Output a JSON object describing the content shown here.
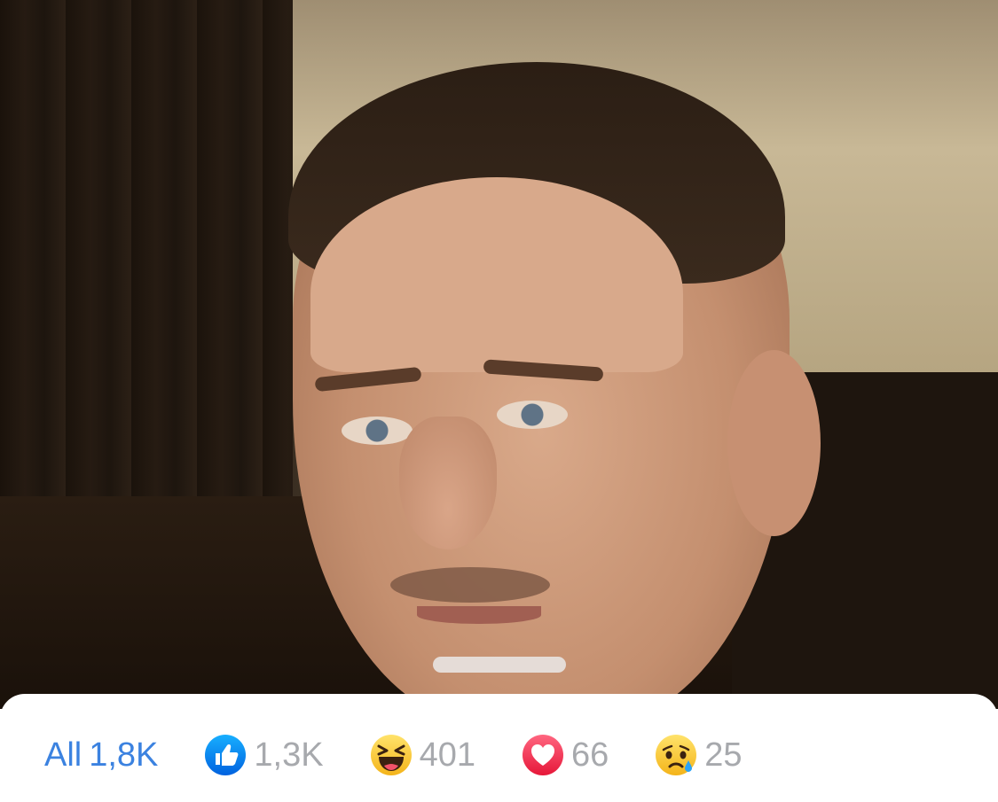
{
  "reactions_bar": {
    "all_label": "All",
    "all_count": "1,8K",
    "items": [
      {
        "icon": "like-icon",
        "count": "1,3K",
        "color": "#1877f2"
      },
      {
        "icon": "haha-icon",
        "count": "401",
        "color": "#f7b928"
      },
      {
        "icon": "love-icon",
        "count": "66",
        "color": "#e41e3f"
      },
      {
        "icon": "sad-icon",
        "count": "25",
        "color": "#f7b928"
      }
    ],
    "active_color": "#3b82e0",
    "inactive_color": "#a7a9ad"
  }
}
